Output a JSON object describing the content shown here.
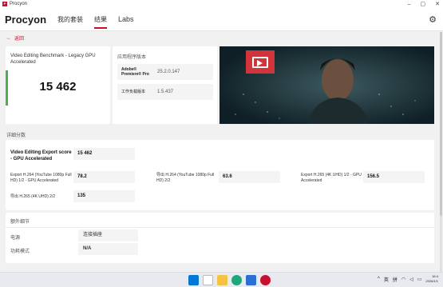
{
  "window": {
    "title": "Procyon",
    "icon": "procyon-app-icon",
    "controls": [
      "–",
      "▢",
      "✕"
    ]
  },
  "header": {
    "brand": "Procyon",
    "tabs": [
      {
        "label": "我的套装",
        "active": false
      },
      {
        "label": "结果",
        "active": true
      },
      {
        "label": "Labs",
        "active": false
      }
    ],
    "settings_icon": "gear-icon"
  },
  "back": {
    "label": "返回",
    "icon": "arrow-left-icon"
  },
  "score_card": {
    "label": "Video Editing Benchmark - Legacy GPU Accelerated",
    "score": "15 462",
    "accent": "#4caf50"
  },
  "version_card": {
    "title": "应用程序版本",
    "rows": [
      {
        "key": "Adobe® Premiere® Pro",
        "value": "25.2.0.147"
      },
      {
        "key": "工作负载版本",
        "value": "1.5.437"
      }
    ]
  },
  "details": {
    "title": "详细分数",
    "main": {
      "label": "Video Editing Export score - GPU Accelerated",
      "value": "15 462"
    },
    "items": [
      {
        "label": "Export H.264 (YouTube 1080p Full HD) 1/2 - GPU Accelerated",
        "value": "78.2"
      },
      {
        "label": "导出 H.264 (YouTube 1080p Full HD) 2/2",
        "value": "63.6"
      },
      {
        "label": "Export H.265 (4K UHD) 1/2 - GPU Accelerated",
        "value": "156.5"
      },
      {
        "label": "导出 H.265 (4K UHD) 2/2",
        "value": "135"
      }
    ]
  },
  "extra": {
    "title": "额外细节",
    "rows": [
      {
        "label": "电源",
        "value": "连接插座"
      },
      {
        "label": "功耗模式",
        "value": "N/A"
      }
    ]
  },
  "taskbar": {
    "apps": [
      "windows-start-icon",
      "search-icon",
      "file-explorer-icon",
      "edge-browser-icon",
      "store-icon",
      "procyon-app-icon"
    ],
    "tray": {
      "lang": "英",
      "ime": "拼",
      "time": "16:4",
      "date": "2026/1/1"
    }
  },
  "colors": {
    "accent": "#c8102e",
    "hero_bg": "#0e1f25",
    "hero_logo": "#d2343c"
  }
}
